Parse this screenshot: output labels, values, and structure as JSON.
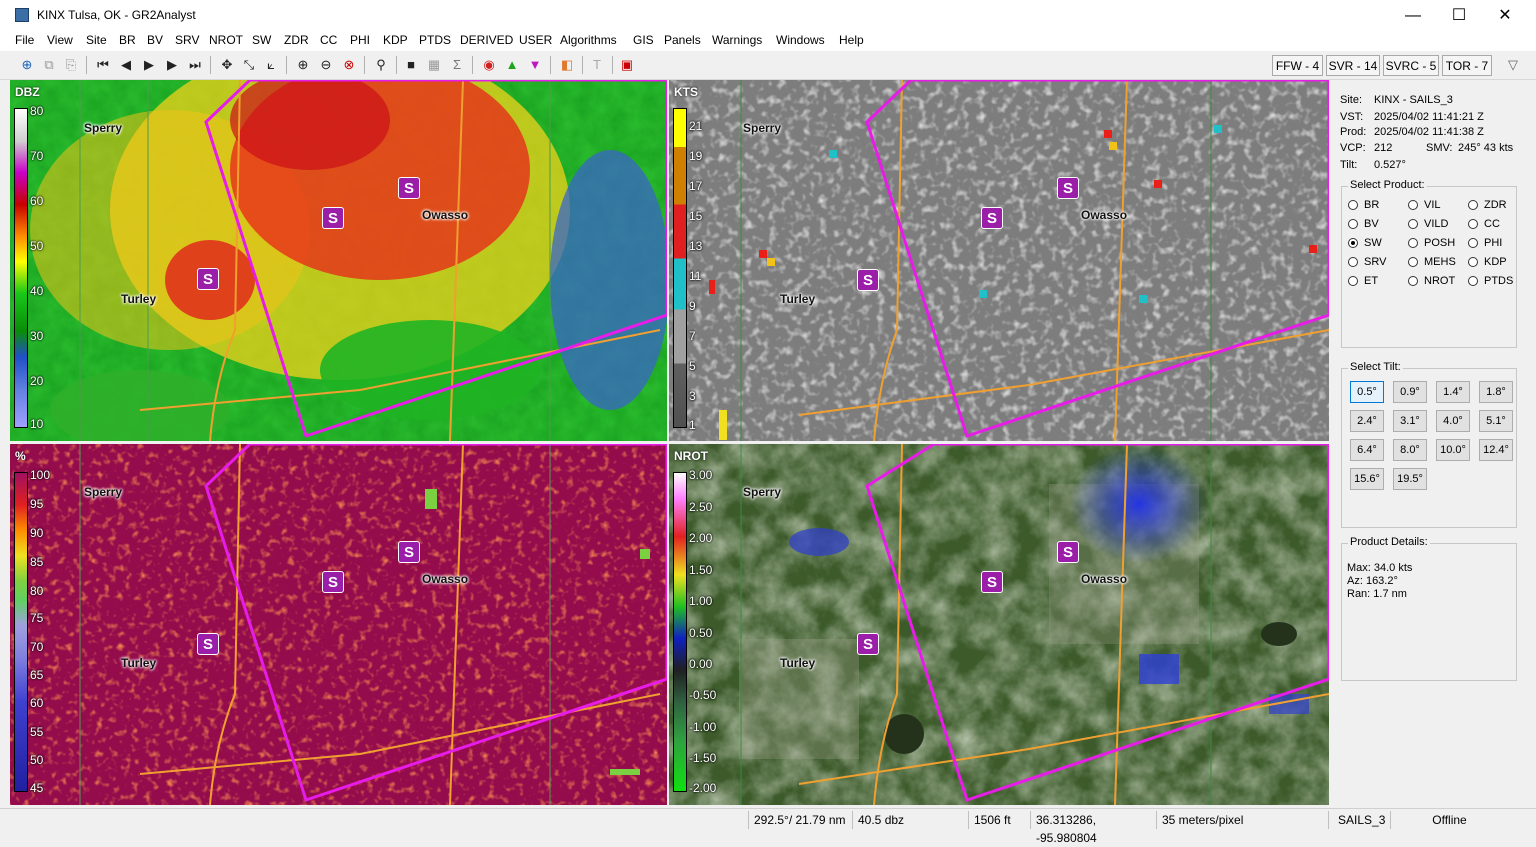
{
  "window": {
    "title": "KINX Tulsa, OK - GR2Analyst",
    "minimize": "—",
    "maximize": "☐",
    "close": "✕"
  },
  "menu": [
    "File",
    "View",
    "Site",
    "BR",
    "BV",
    "SRV",
    "NROT",
    "SW",
    "ZDR",
    "CC",
    "PHI",
    "KDP",
    "PTDS",
    "DERIVED",
    "USER",
    "Algorithms",
    "GIS",
    "Panels",
    "Warnings",
    "Windows",
    "Help"
  ],
  "toolbar": {
    "icons": [
      "⊕",
      "⧉",
      "⎘",
      "⏮",
      "◀",
      "▶",
      "▶",
      "⏭",
      "✥",
      "⤡",
      "⟀",
      "⊕",
      "⊖",
      "⊗",
      "⚲",
      "■",
      "▦",
      "Σ",
      "◉",
      "▲",
      "▼",
      "◧",
      "T",
      "▣"
    ],
    "warnings": [
      "FFW - 4",
      "SVR - 14",
      "SVRC - 5",
      "TOR - 7"
    ],
    "filter_icon": "▽"
  },
  "colors": {
    "warning_polygon": "#e81ce8",
    "road": "#f0a030",
    "tornado_marker": "#9b1ea8"
  },
  "cities": [
    "Sperry",
    "Owasso",
    "Turley"
  ],
  "panels": {
    "p1": {
      "product": "DBZ",
      "labels": [
        "80",
        "70",
        "60",
        "50",
        "40",
        "30",
        "20",
        "10"
      ]
    },
    "p2": {
      "product": "KTS",
      "labels": [
        "21",
        "19",
        "17",
        "15",
        "13",
        "11",
        "9",
        "7",
        "5",
        "3",
        "1"
      ]
    },
    "p3": {
      "product": "%",
      "labels": [
        "100",
        "95",
        "90",
        "85",
        "80",
        "75",
        "70",
        "65",
        "60",
        "55",
        "50",
        "45"
      ]
    },
    "p4": {
      "product": "NROT",
      "labels": [
        "3.00",
        "2.50",
        "2.00",
        "1.50",
        "1.00",
        "0.50",
        "0.00",
        "-0.50",
        "-1.00",
        "-1.50",
        "-2.00"
      ]
    }
  },
  "tornado_symbol": "S",
  "info": {
    "site_label": "Site:",
    "site": "KINX - SAILS_3",
    "vst_label": "VST:",
    "vst": "2025/04/02  11:41:21 Z",
    "prod_label": "Prod:",
    "prod": "2025/04/02  11:41:38 Z",
    "vcp_label": "VCP:",
    "vcp": "212",
    "smv_label": "SMV:",
    "smv": "245° 43 kts",
    "tilt_label": "Tilt:",
    "tilt": "0.527°"
  },
  "select_product": {
    "title": "Select Product:",
    "columns": [
      [
        "BR",
        "BV",
        "SW",
        "SRV",
        "ET"
      ],
      [
        "VIL",
        "VILD",
        "POSH",
        "MEHS",
        "NROT"
      ],
      [
        "ZDR",
        "CC",
        "PHI",
        "KDP",
        "PTDS"
      ]
    ],
    "selected": "SW"
  },
  "select_tilt": {
    "title": "Select Tilt:",
    "tilts": [
      "0.5°",
      "0.9°",
      "1.4°",
      "1.8°",
      "2.4°",
      "3.1°",
      "4.0°",
      "5.1°",
      "6.4°",
      "8.0°",
      "10.0°",
      "12.4°",
      "15.6°",
      "19.5°"
    ],
    "selected": "0.5°"
  },
  "product_details": {
    "title": "Product Details:",
    "max": "Max:  34.0 kts",
    "az": "Az:   163.2°",
    "ran": "Ran:  1.7 nm"
  },
  "status": [
    "292.5°/ 21.79 nm",
    "40.5 dbz",
    "1506 ft",
    "36.313286, -95.980804",
    "35 meters/pixel",
    "SAILS_3",
    "Offline"
  ]
}
